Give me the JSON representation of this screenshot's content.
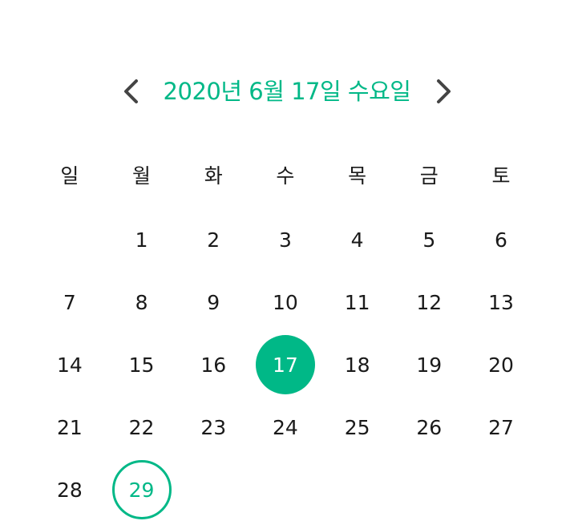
{
  "header": {
    "title": "2020년 6월 17일 수요일",
    "prev_icon": "chevron-left-icon",
    "next_icon": "chevron-right-icon"
  },
  "weekdays": [
    "일",
    "월",
    "화",
    "수",
    "목",
    "금",
    "토"
  ],
  "weeks": [
    [
      "",
      "1",
      "2",
      "3",
      "4",
      "5",
      "6"
    ],
    [
      "7",
      "8",
      "9",
      "10",
      "11",
      "12",
      "13"
    ],
    [
      "14",
      "15",
      "16",
      "17",
      "18",
      "19",
      "20"
    ],
    [
      "21",
      "22",
      "23",
      "24",
      "25",
      "26",
      "27"
    ],
    [
      "28",
      "29",
      "",
      "",
      "",
      "",
      ""
    ]
  ],
  "selected_day": "17",
  "today_day": "29",
  "colors": {
    "accent": "#00b887",
    "text": "#1a1a1a",
    "nav_icon": "#444444"
  }
}
